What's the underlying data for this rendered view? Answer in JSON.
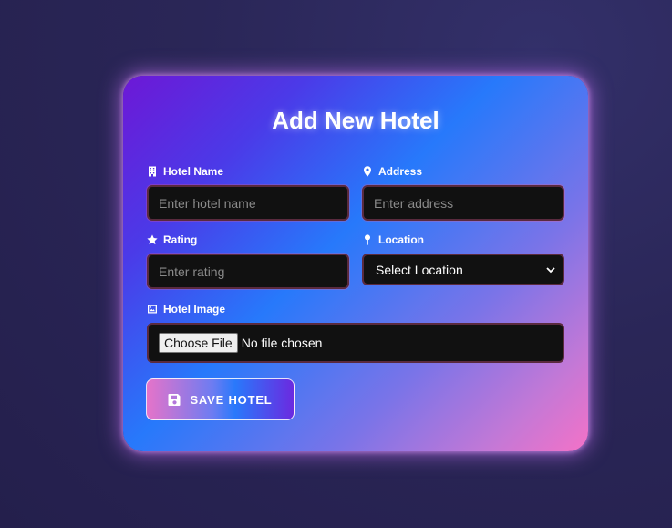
{
  "form": {
    "title": "Add New Hotel",
    "fields": {
      "hotel_name": {
        "label": "Hotel Name",
        "placeholder": "Enter hotel name",
        "icon": "building-icon"
      },
      "address": {
        "label": "Address",
        "placeholder": "Enter address",
        "icon": "map-pin-icon"
      },
      "rating": {
        "label": "Rating",
        "placeholder": "Enter rating",
        "icon": "star-icon"
      },
      "location": {
        "label": "Location",
        "selected": "Select Location",
        "icon": "location-pin-icon"
      },
      "hotel_image": {
        "label": "Hotel Image",
        "button": "Choose File",
        "status": "No file chosen",
        "icon": "image-icon"
      }
    },
    "save_button": {
      "label": "SAVE HOTEL",
      "icon": "save-icon"
    }
  },
  "colors": {
    "card_gradient": [
      "#6d18d6",
      "#2779fb",
      "#f472c7"
    ],
    "input_bg": "#111111",
    "input_border": "#5a2a3e",
    "page_bg": "#2a2657"
  }
}
